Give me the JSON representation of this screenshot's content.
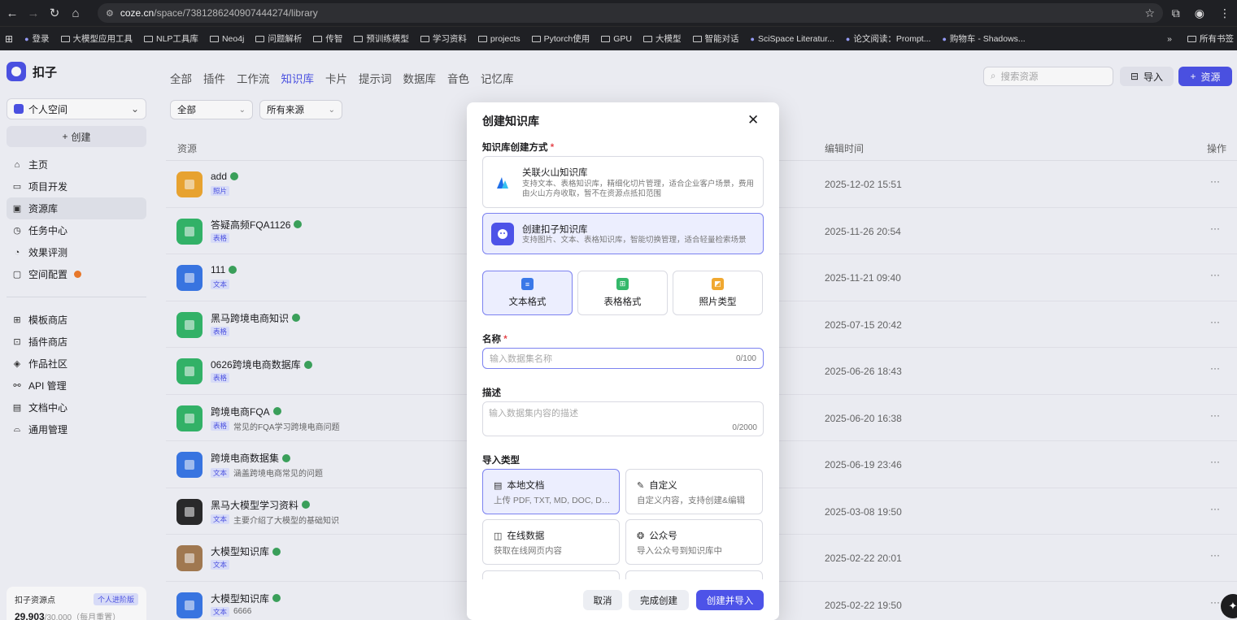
{
  "browser": {
    "url_host": "coze.cn",
    "url_path": "/space/7381286240907444274/library",
    "bookmarks": [
      {
        "label": "登录",
        "type": "site"
      },
      {
        "label": "大模型应用工具",
        "type": "folder"
      },
      {
        "label": "NLP工具库",
        "type": "folder"
      },
      {
        "label": "Neo4j",
        "type": "folder"
      },
      {
        "label": "问题解析",
        "type": "folder"
      },
      {
        "label": "传智",
        "type": "folder"
      },
      {
        "label": "预训练模型",
        "type": "folder"
      },
      {
        "label": "学习资料",
        "type": "folder"
      },
      {
        "label": "projects",
        "type": "folder"
      },
      {
        "label": "Pytorch使用",
        "type": "folder"
      },
      {
        "label": "GPU",
        "type": "folder"
      },
      {
        "label": "大模型",
        "type": "folder"
      },
      {
        "label": "智能对话",
        "type": "folder"
      },
      {
        "label": "SciSpace Literatur...",
        "type": "site"
      },
      {
        "label": "论文阅读：Prompt...",
        "type": "site"
      },
      {
        "label": "购物车 - Shadows...",
        "type": "site"
      }
    ],
    "more": "»",
    "all_bookmarks": "所有书签"
  },
  "sidebar": {
    "brand": "扣子",
    "space": "个人空间",
    "create_label": "创建",
    "nav_primary": [
      {
        "label": "主页",
        "icon": "home-icon",
        "glyph": "⌂"
      },
      {
        "label": "项目开发",
        "icon": "project-icon",
        "glyph": "▭"
      },
      {
        "label": "资源库",
        "icon": "library-icon",
        "glyph": "▣",
        "active": true
      },
      {
        "label": "任务中心",
        "icon": "task-icon",
        "glyph": "◷"
      },
      {
        "label": "效果评测",
        "icon": "eval-icon",
        "glyph": "◔"
      },
      {
        "label": "空间配置",
        "icon": "settings-icon",
        "glyph": "▢",
        "dot": true
      }
    ],
    "nav_secondary": [
      {
        "label": "模板商店",
        "icon": "template-icon",
        "glyph": "⊞"
      },
      {
        "label": "插件商店",
        "icon": "plugin-icon",
        "glyph": "⊡"
      },
      {
        "label": "作品社区",
        "icon": "community-icon",
        "glyph": "◈"
      },
      {
        "label": "API 管理",
        "icon": "api-icon",
        "glyph": "⚯"
      },
      {
        "label": "文档中心",
        "icon": "doc-icon",
        "glyph": "▤"
      },
      {
        "label": "通用管理",
        "icon": "manage-icon",
        "glyph": "⌓"
      }
    ],
    "points": {
      "title": "扣子资源点",
      "badge": "个人进阶版",
      "value": "29,903",
      "total": "/30,000（每月重置）"
    }
  },
  "main": {
    "tabs": [
      {
        "label": "全部"
      },
      {
        "label": "插件"
      },
      {
        "label": "工作流"
      },
      {
        "label": "知识库",
        "active": true
      },
      {
        "label": "卡片"
      },
      {
        "label": "提示词"
      },
      {
        "label": "数据库"
      },
      {
        "label": "音色"
      },
      {
        "label": "记忆库"
      }
    ],
    "search_placeholder": "搜索资源",
    "import_label": "导入",
    "resource_label": "资源",
    "filter_type": "全部",
    "filter_source": "所有来源",
    "columns": {
      "resource": "资源",
      "edit_time": "编辑时间",
      "actions": "操作"
    },
    "rows": [
      {
        "name": "add",
        "tag": "照片",
        "desc": "",
        "time": "2025-12-02 15:51",
        "color": "#f0a830"
      },
      {
        "name": "答疑高频FQA1126",
        "tag": "表格",
        "desc": "",
        "time": "2025-11-26 20:54",
        "color": "#34b86a"
      },
      {
        "name": "111",
        "tag": "文本",
        "desc": "",
        "time": "2025-11-21 09:40",
        "color": "#3a78e8"
      },
      {
        "name": "黑马跨境电商知识",
        "tag": "表格",
        "desc": "",
        "time": "2025-07-15 20:42",
        "color": "#34b86a"
      },
      {
        "name": "0626跨境电商数据库",
        "tag": "表格",
        "desc": "",
        "time": "2025-06-26 18:43",
        "color": "#34b86a"
      },
      {
        "name": "跨境电商FQA",
        "tag": "表格",
        "desc": "常见的FQA学习跨境电商问题",
        "time": "2025-06-20 16:38",
        "color": "#34b86a"
      },
      {
        "name": "跨境电商数据集",
        "tag": "文本",
        "desc": "涵盖跨境电商常见的问题",
        "time": "2025-06-19 23:46",
        "color": "#3a78e8"
      },
      {
        "name": "黑马大模型学习资料",
        "tag": "文本",
        "desc": "主要介绍了大模型的基础知识",
        "time": "2025-03-08 19:50",
        "color": "#2a2a2a"
      },
      {
        "name": "大模型知识库",
        "tag": "文本",
        "desc": "",
        "time": "2025-02-22 20:01",
        "color": "#a67c52"
      },
      {
        "name": "大模型知识库",
        "tag": "文本",
        "desc": "6666",
        "time": "2025-02-22 19:50",
        "color": "#3a78e8"
      }
    ],
    "row_action": "···"
  },
  "modal": {
    "title": "创建知识库",
    "method_label": "知识库创建方式",
    "methods": [
      {
        "title": "关联火山知识库",
        "desc": "支持文本、表格知识库，精细化切片管理，适合企业客户场景，费用由火山方舟收取，暂不在资源点抵扣范围",
        "selected": false
      },
      {
        "title": "创建扣子知识库",
        "desc": "支持图片、文本、表格知识库，智能切换管理，适合轻量检索场景",
        "selected": true
      }
    ],
    "formats": [
      {
        "label": "文本格式",
        "color": "#3a78e8",
        "glyph": "≡",
        "selected": true
      },
      {
        "label": "表格格式",
        "color": "#34b86a",
        "glyph": "⊞",
        "selected": false
      },
      {
        "label": "照片类型",
        "color": "#f0a830",
        "glyph": "◩",
        "selected": false
      }
    ],
    "name_label": "名称",
    "name_placeholder": "输入数据集名称",
    "name_count": "0/100",
    "desc_label": "描述",
    "desc_placeholder": "输入数据集内容的描述",
    "desc_count": "0/2000",
    "import_label": "导入类型",
    "import_types": [
      {
        "title": "本地文档",
        "desc": "上传 PDF, TXT, MD, DOC, DOCX 格式的本地文件",
        "glyph": "▤",
        "selected": true
      },
      {
        "title": "自定义",
        "desc": "自定义内容，支持创建&编辑",
        "glyph": "✎",
        "selected": false
      },
      {
        "title": "在线数据",
        "desc": "获取在线网页内容",
        "glyph": "◫",
        "selected": false
      },
      {
        "title": "公众号",
        "desc": "导入公众号到知识库中",
        "glyph": "❂",
        "selected": false
      }
    ],
    "cancel_label": "取消",
    "done_label": "完成创建",
    "create_import_label": "创建并导入"
  }
}
